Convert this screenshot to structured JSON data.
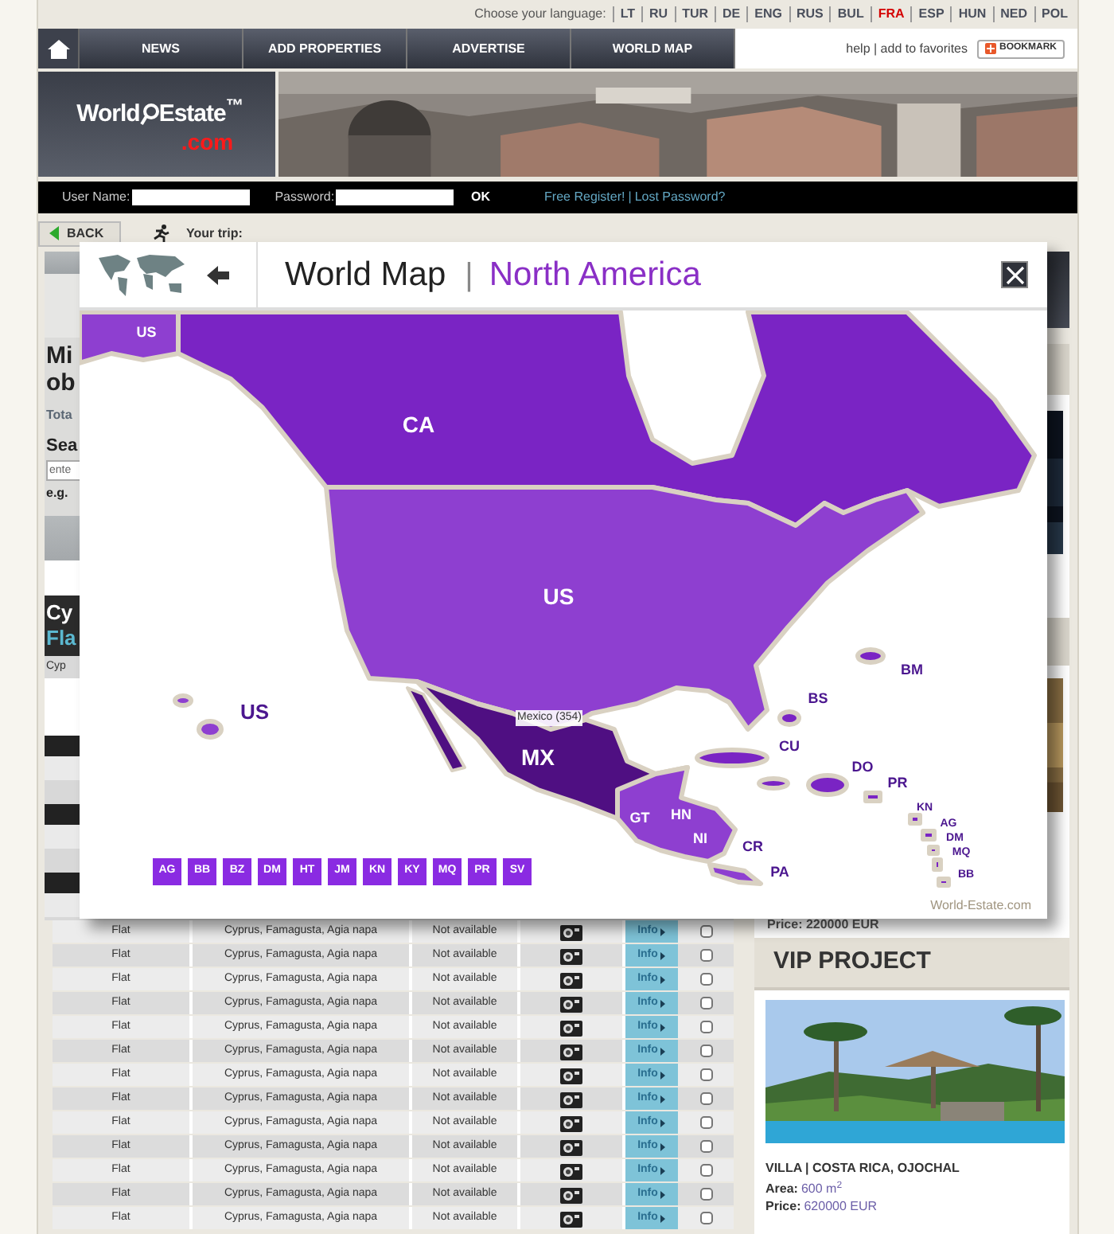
{
  "languages": {
    "prompt": "Choose your language:",
    "items": [
      {
        "label": "LT",
        "selected": false
      },
      {
        "label": "RU",
        "selected": false
      },
      {
        "label": "TUR",
        "selected": false
      },
      {
        "label": "DE",
        "selected": false
      },
      {
        "label": "ENG",
        "selected": false
      },
      {
        "label": "RUS",
        "selected": false
      },
      {
        "label": "BUL",
        "selected": false
      },
      {
        "label": "FRA",
        "selected": true
      },
      {
        "label": "ESP",
        "selected": false
      },
      {
        "label": "HUN",
        "selected": false
      },
      {
        "label": "NED",
        "selected": false
      },
      {
        "label": "POL",
        "selected": false
      }
    ]
  },
  "nav": {
    "items": [
      "NEWS",
      "ADD PROPERTIES",
      "ADVERTISE",
      "WORLD MAP"
    ],
    "links": "help | add to favorites",
    "bookmark": "BOOKMARK"
  },
  "logo": {
    "word1": "World",
    "word2": "Estate$^{™}$",
    "domain": ".com"
  },
  "login": {
    "username_label": "User Name:",
    "password_label": "Password:",
    "ok": "OK",
    "register": "Free Register!",
    "separator": "|",
    "lost": "Lost Password?"
  },
  "trip_bar": {
    "back": "BACK",
    "trip": "Your trip:"
  },
  "left_panel": {
    "heading_lines": [
      "Mi",
      "ob"
    ],
    "total": "Tota",
    "search_label": "Sea",
    "search_placeholder": "ente",
    "example": "e.g.",
    "listing_title": "Cy",
    "listing_type": "Fla",
    "listing_location": "Cyp"
  },
  "modal": {
    "title": "World Map",
    "separator": "|",
    "region": "North America",
    "labels": [
      {
        "text": "US",
        "kind": "inside"
      },
      {
        "text": "CA",
        "kind": "major"
      },
      {
        "text": "US",
        "kind": "major"
      },
      {
        "text": "US",
        "kind": "outer-major"
      },
      {
        "text": "BM",
        "kind": "outer"
      },
      {
        "text": "BS",
        "kind": "outer"
      },
      {
        "text": "CU",
        "kind": "outer"
      },
      {
        "text": "DO",
        "kind": "outer"
      },
      {
        "text": "PR",
        "kind": "outer"
      },
      {
        "text": "MX",
        "kind": "major"
      },
      {
        "text": "GT",
        "kind": "inside"
      },
      {
        "text": "HN",
        "kind": "inside"
      },
      {
        "text": "NI",
        "kind": "inside"
      },
      {
        "text": "CR",
        "kind": "outer"
      },
      {
        "text": "PA",
        "kind": "outer"
      },
      {
        "text": "KN",
        "kind": "tiny"
      },
      {
        "text": "AG",
        "kind": "tiny"
      },
      {
        "text": "DM",
        "kind": "tiny"
      },
      {
        "text": "MQ",
        "kind": "tiny"
      },
      {
        "text": "BB",
        "kind": "tiny"
      }
    ],
    "tooltip": "Mexico (354)",
    "buttons": [
      "AG",
      "BB",
      "BZ",
      "DM",
      "HT",
      "JM",
      "KN",
      "KY",
      "MQ",
      "PR",
      "SV"
    ],
    "credit": "World-Estate.com"
  },
  "listings": {
    "rows": [
      {
        "type": "Flat",
        "location": "Cyprus, Famagusta, Agia napa",
        "availability": "Not available",
        "info": "Info",
        "checked": false
      },
      {
        "type": "Flat",
        "location": "Cyprus, Famagusta, Agia napa",
        "availability": "Not available",
        "info": "Info",
        "checked": false
      },
      {
        "type": "Flat",
        "location": "Cyprus, Famagusta, Agia napa",
        "availability": "Not available",
        "info": "Info",
        "checked": false
      },
      {
        "type": "Flat",
        "location": "Cyprus, Famagusta, Agia napa",
        "availability": "Not available",
        "info": "Info",
        "checked": false
      },
      {
        "type": "Flat",
        "location": "Cyprus, Famagusta, Agia napa",
        "availability": "Not available",
        "info": "Info",
        "checked": false
      },
      {
        "type": "Flat",
        "location": "Cyprus, Famagusta, Agia napa",
        "availability": "Not available",
        "info": "Info",
        "checked": false
      },
      {
        "type": "Flat",
        "location": "Cyprus, Famagusta, Agia napa",
        "availability": "Not available",
        "info": "Info",
        "checked": false
      },
      {
        "type": "Flat",
        "location": "Cyprus, Famagusta, Agia napa",
        "availability": "Not available",
        "info": "Info",
        "checked": false
      },
      {
        "type": "Flat",
        "location": "Cyprus, Famagusta, Agia napa",
        "availability": "Not available",
        "info": "Info",
        "checked": false
      },
      {
        "type": "Flat",
        "location": "Cyprus, Famagusta, Agia napa",
        "availability": "Not available",
        "info": "Info",
        "checked": false
      },
      {
        "type": "Flat",
        "location": "Cyprus, Famagusta, Agia napa",
        "availability": "Not available",
        "info": "Info",
        "checked": false
      },
      {
        "type": "Flat",
        "location": "Cyprus, Famagusta, Agia napa",
        "availability": "Not available",
        "info": "Info",
        "checked": false
      },
      {
        "type": "Flat",
        "location": "Cyprus, Famagusta, Agia napa",
        "availability": "Not available",
        "info": "Info",
        "checked": false
      }
    ]
  },
  "sidebar": {
    "price_peek": "Price: 220000 EUR",
    "vip": {
      "heading": "VIP PROJECT",
      "title": "VILLA | COSTA RICA, OJOCHAL",
      "area_label": "Area:",
      "area": "600 m$^{2}$",
      "price_label": "Price:",
      "price": "620000 EUR"
    }
  }
}
